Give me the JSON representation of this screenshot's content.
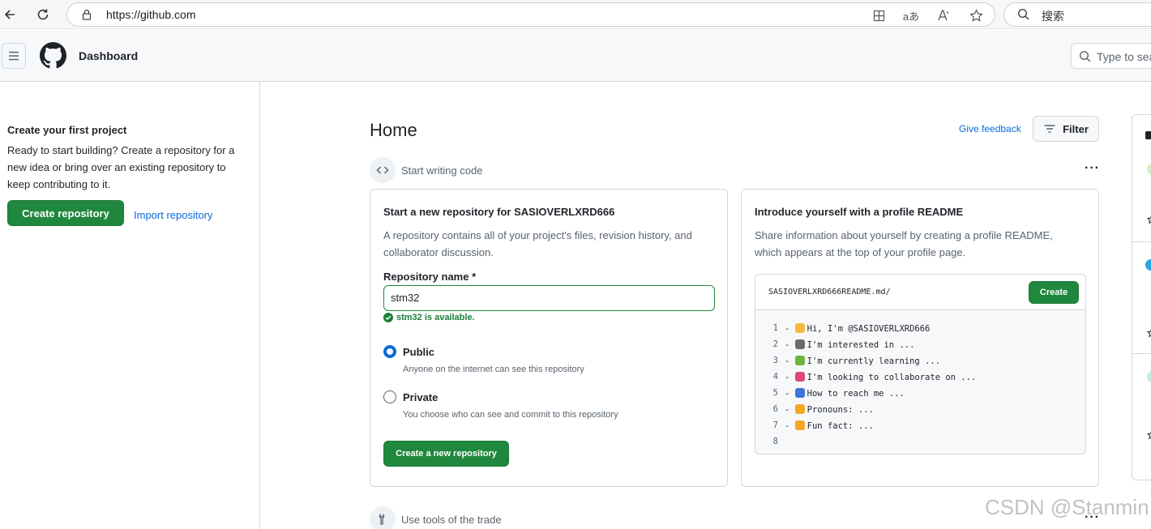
{
  "browser": {
    "url": "https://github.com",
    "search_placeholder": "搜索",
    "addr_icon_read": "aあ"
  },
  "header": {
    "title": "Dashboard",
    "search_placeholder": "Type to sea"
  },
  "sidebar": {
    "title": "Create your first project",
    "description": "Ready to start building? Create a repository for a new idea or bring over an existing repository to keep contributing to it.",
    "create_label": "Create repository",
    "import_label": "Import repository"
  },
  "main": {
    "title": "Home",
    "feedback_label": "Give feedback",
    "filter_label": "Filter",
    "section1_label": "Start writing code",
    "section2_label": "Use tools of the trade",
    "more_label": "···"
  },
  "new_repo_card": {
    "title": "Start a new repository for SASIOVERLXRD666",
    "description": "A repository contains all of your project's files, revision history, and collaborator discussion.",
    "name_label": "Repository name *",
    "name_value": "stm32",
    "available_text": "stm32 is available.",
    "public_label": "Public",
    "public_help": "Anyone on the internet can see this repository",
    "private_label": "Private",
    "private_help": "You choose who can see and commit to this repository",
    "visibility_selected": "Public",
    "create_label": "Create a new repository"
  },
  "readme_card": {
    "title": "Introduce yourself with a profile README",
    "description": "Share information about yourself by creating a profile README, which appears at the top of your profile page.",
    "path": "SASIOVERLXRD666README.md/",
    "create_label": "Create",
    "lines": [
      {
        "num": "1",
        "emoji": "wave",
        "color": "#f5b93f",
        "text": "Hi, I'm @SASIOVERLXRD666"
      },
      {
        "num": "2",
        "emoji": "eyes",
        "color": "#6b6b6b",
        "text": "I'm interested in ..."
      },
      {
        "num": "3",
        "emoji": "seedling",
        "color": "#6db33f",
        "text": "I'm currently learning ..."
      },
      {
        "num": "4",
        "emoji": "heart",
        "color": "#e0457b",
        "text": "I'm looking to collaborate on ..."
      },
      {
        "num": "5",
        "emoji": "mailbox",
        "color": "#3f74d6",
        "text": "How to reach me ..."
      },
      {
        "num": "6",
        "emoji": "smile",
        "color": "#f5a623",
        "text": "Pronouns: ..."
      },
      {
        "num": "7",
        "emoji": "zap",
        "color": "#f5a623",
        "text": "Fun fact: ..."
      },
      {
        "num": "8",
        "emoji": "",
        "color": "",
        "text": ""
      }
    ]
  },
  "watermark": "CSDN @Stanmin"
}
